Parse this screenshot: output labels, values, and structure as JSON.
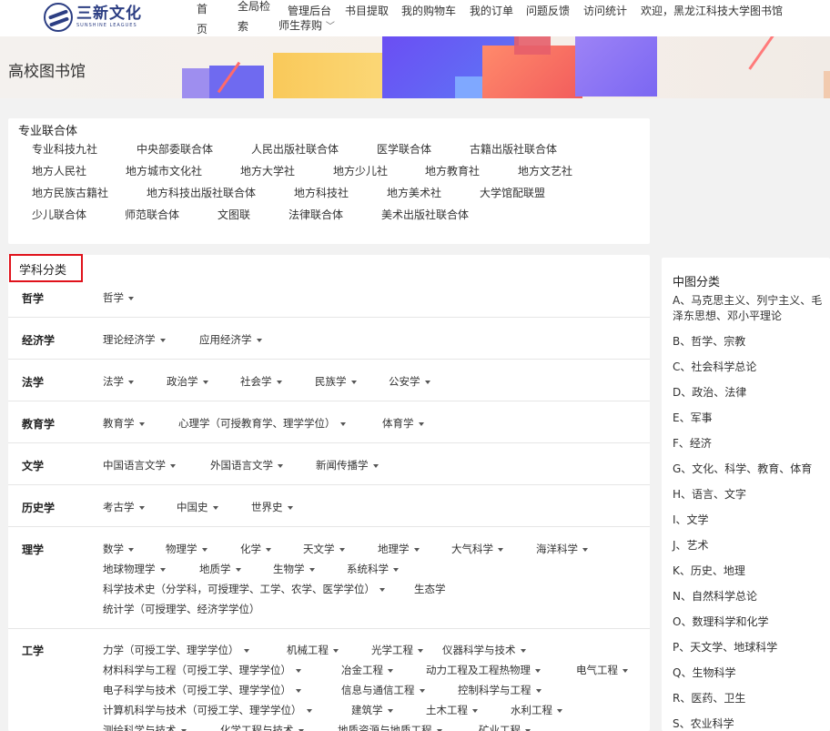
{
  "header": {
    "logo_text": "三新文化",
    "logo_sub": "SUNSHINE LEAGUES",
    "nav": {
      "home": "首页",
      "search": "全局检索",
      "admin": "管理后台",
      "fetch": "书目提取",
      "cart": "我的购物车",
      "orders": "我的订单",
      "feedback": "问题反馈",
      "stats": "访问统计",
      "recommend": "师生荐购",
      "welcome": "欢迎，黑龙江科技大学图书馆"
    }
  },
  "banner": {
    "title": "高校图书馆"
  },
  "union": {
    "title": "专业联合体",
    "rows": [
      [
        "专业科技九社",
        "中央部委联合体",
        "人民出版社联合体",
        "医学联合体",
        "古籍出版社联合体"
      ],
      [
        "地方人民社",
        "地方城市文化社",
        "地方大学社",
        "地方少儿社",
        "地方教育社",
        "地方文艺社"
      ],
      [
        "地方民族古籍社",
        "地方科技出版社联合体",
        "地方科技社",
        "地方美术社",
        "大学馆配联盟"
      ],
      [
        "少儿联合体",
        "师范联合体",
        "文图联",
        "法律联合体",
        "美术出版社联合体"
      ]
    ]
  },
  "subjects": {
    "title": "学科分类",
    "groups": [
      {
        "label": "哲学",
        "lines": [
          [
            "哲学"
          ]
        ]
      },
      {
        "label": "经济学",
        "lines": [
          [
            "理论经济学",
            "应用经济学"
          ]
        ]
      },
      {
        "label": "法学",
        "lines": [
          [
            "法学",
            "政治学",
            "社会学",
            "民族学",
            "公安学"
          ]
        ]
      },
      {
        "label": "教育学",
        "lines": [
          [
            "教育学",
            "心理学（可授教育学、理学学位）",
            "体育学"
          ]
        ]
      },
      {
        "label": "文学",
        "lines": [
          [
            "中国语言文学",
            "外国语言文学",
            "新闻传播学"
          ]
        ]
      },
      {
        "label": "历史学",
        "lines": [
          [
            "考古学",
            "中国史",
            "世界史"
          ]
        ]
      },
      {
        "label": "理学",
        "lines": [
          [
            "数学",
            "物理学",
            "化学",
            "天文学",
            "地理学",
            "大气科学",
            "海洋科学"
          ],
          [
            "地球物理学",
            "地质学",
            "生物学",
            "系统科学"
          ],
          [
            "科学技术史（分学科，可授理学、工学、农学、医学学位）",
            "生态学"
          ],
          [
            "统计学（可授理学、经济学学位）"
          ]
        ]
      },
      {
        "label": "工学",
        "lines": [
          [
            "力学（可授工学、理学学位）",
            "机械工程",
            "光学工程",
            "仪器科学与技术"
          ],
          [
            "材料科学与工程（可授工学、理学学位）",
            "冶金工程",
            "动力工程及工程热物理",
            "电气工程"
          ],
          [
            "电子科学与技术（可授工学、理学学位）",
            "信息与通信工程",
            "控制科学与工程"
          ],
          [
            "计算机科学与技术（可授工学、理学学位）",
            "建筑学",
            "土木工程",
            "水利工程"
          ],
          [
            "测绘科学与技术",
            "化学工程与技术",
            "地质资源与地质工程",
            "矿业工程"
          ]
        ]
      }
    ]
  },
  "clc": {
    "title": "中图分类",
    "items": [
      "A、马克思主义、列宁主义、毛泽东思想、邓小平理论",
      "B、哲学、宗教",
      "C、社会科学总论",
      "D、政治、法律",
      "E、军事",
      "F、经济",
      "G、文化、科学、教育、体育",
      "H、语言、文字",
      "I、文学",
      "J、艺术",
      "K、历史、地理",
      "N、自然科学总论",
      "O、数理科学和化学",
      "P、天文学、地球科学",
      "Q、生物科学",
      "R、医药、卫生",
      "S、农业科学"
    ]
  }
}
